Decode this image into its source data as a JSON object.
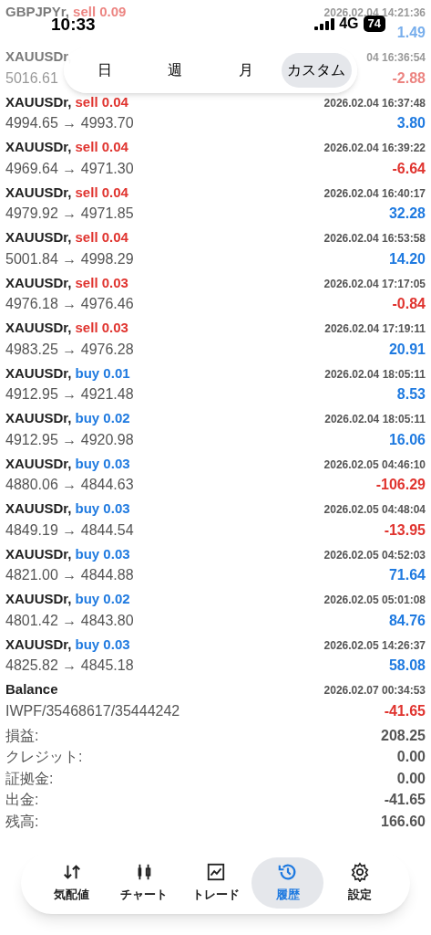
{
  "status_bar": {
    "time": "10:33",
    "network": "4G",
    "battery": "74"
  },
  "period_tabs": [
    {
      "label": "日",
      "selected": false
    },
    {
      "label": "週",
      "selected": false
    },
    {
      "label": "月",
      "selected": false
    },
    {
      "label": "カスタム",
      "selected": true
    }
  ],
  "deals": [
    {
      "symbol": "GBPJPYr,",
      "side": "sell",
      "volume": "0.09",
      "time": "2026.02.04 14:21:36",
      "profit": "1.49",
      "loss": false,
      "faded": true
    },
    {
      "symbol": "XAUUSDr,",
      "prices": "5016.61",
      "time": "04 16:36:54",
      "profit": "-2.88",
      "loss": true,
      "faded": true
    },
    {
      "symbol": "XAUUSDr,",
      "side": "sell",
      "volume": "0.04",
      "prices": "4994.65 → 4993.70",
      "time": "2026.02.04 16:37:48",
      "profit": "3.80",
      "loss": false,
      "faded": false
    },
    {
      "symbol": "XAUUSDr,",
      "side": "sell",
      "volume": "0.04",
      "prices": "4969.64 → 4971.30",
      "time": "2026.02.04 16:39:22",
      "profit": "-6.64",
      "loss": true,
      "faded": false
    },
    {
      "symbol": "XAUUSDr,",
      "side": "sell",
      "volume": "0.04",
      "prices": "4979.92 → 4971.85",
      "time": "2026.02.04 16:40:17",
      "profit": "32.28",
      "loss": false,
      "faded": false
    },
    {
      "symbol": "XAUUSDr,",
      "side": "sell",
      "volume": "0.04",
      "prices": "5001.84 → 4998.29",
      "time": "2026.02.04 16:53:58",
      "profit": "14.20",
      "loss": false,
      "faded": false
    },
    {
      "symbol": "XAUUSDr,",
      "side": "sell",
      "volume": "0.03",
      "prices": "4976.18 → 4976.46",
      "time": "2026.02.04 17:17:05",
      "profit": "-0.84",
      "loss": true,
      "faded": false
    },
    {
      "symbol": "XAUUSDr,",
      "side": "sell",
      "volume": "0.03",
      "prices": "4983.25 → 4976.28",
      "time": "2026.02.04 17:19:11",
      "profit": "20.91",
      "loss": false,
      "faded": false
    },
    {
      "symbol": "XAUUSDr,",
      "side": "buy",
      "volume": "0.01",
      "prices": "4912.95 → 4921.48",
      "time": "2026.02.04 18:05:11",
      "profit": "8.53",
      "loss": false,
      "faded": false
    },
    {
      "symbol": "XAUUSDr,",
      "side": "buy",
      "volume": "0.02",
      "prices": "4912.95 → 4920.98",
      "time": "2026.02.04 18:05:11",
      "profit": "16.06",
      "loss": false,
      "faded": false
    },
    {
      "symbol": "XAUUSDr,",
      "side": "buy",
      "volume": "0.03",
      "prices": "4880.06 → 4844.63",
      "time": "2026.02.05 04:46:10",
      "profit": "-106.29",
      "loss": true,
      "faded": false
    },
    {
      "symbol": "XAUUSDr,",
      "side": "buy",
      "volume": "0.03",
      "prices": "4849.19 → 4844.54",
      "time": "2026.02.05 04:48:04",
      "profit": "-13.95",
      "loss": true,
      "faded": false
    },
    {
      "symbol": "XAUUSDr,",
      "side": "buy",
      "volume": "0.03",
      "prices": "4821.00 → 4844.88",
      "time": "2026.02.05 04:52:03",
      "profit": "71.64",
      "loss": false,
      "faded": false
    },
    {
      "symbol": "XAUUSDr,",
      "side": "buy",
      "volume": "0.02",
      "prices": "4801.42 → 4843.80",
      "time": "2026.02.05 05:01:08",
      "profit": "84.76",
      "loss": false,
      "faded": false
    },
    {
      "symbol": "XAUUSDr,",
      "side": "buy",
      "volume": "0.03",
      "prices": "4825.82 → 4845.18",
      "time": "2026.02.05 14:26:37",
      "profit": "58.08",
      "loss": false,
      "faded": false
    },
    {
      "symbol": "Balance",
      "prices": "IWPF/35468617/35444242",
      "time": "2026.02.07 00:34:53",
      "profit": "-41.65",
      "loss": true,
      "faded": false
    }
  ],
  "summary": [
    {
      "label": "損益:",
      "value": "208.25"
    },
    {
      "label": "クレジット:",
      "value": "0.00"
    },
    {
      "label": "証拠金:",
      "value": "0.00"
    },
    {
      "label": "出金:",
      "value": "-41.65"
    },
    {
      "label": "残高:",
      "value": "166.60"
    }
  ],
  "nav": [
    {
      "kind": "quotes",
      "label": "気配値",
      "selected": false
    },
    {
      "kind": "chart",
      "label": "チャート",
      "selected": false
    },
    {
      "kind": "trade",
      "label": "トレード",
      "selected": false
    },
    {
      "kind": "history",
      "label": "履歴",
      "selected": true
    },
    {
      "kind": "settings",
      "label": "設定",
      "selected": false
    }
  ]
}
